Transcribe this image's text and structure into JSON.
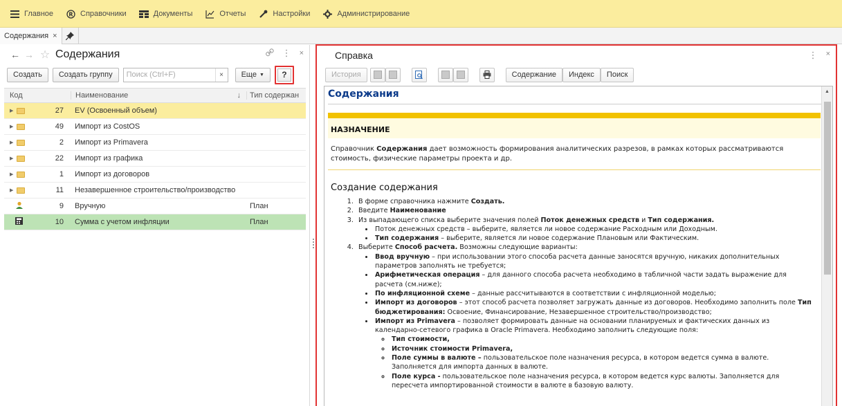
{
  "menu": [
    {
      "label": "Главное",
      "icon": "hamburger-icon"
    },
    {
      "label": "Справочники",
      "icon": "registered-icon"
    },
    {
      "label": "Документы",
      "icon": "documents-icon"
    },
    {
      "label": "Отчеты",
      "icon": "chart-icon"
    },
    {
      "label": "Настройки",
      "icon": "wrench-icon"
    },
    {
      "label": "Администрирование",
      "icon": "gear-icon"
    }
  ],
  "tabs": {
    "active": "Содержания",
    "close": "×"
  },
  "left": {
    "title": "Содержания",
    "create": "Создать",
    "create_group": "Создать группу",
    "search_placeholder": "Поиск (Ctrl+F)",
    "clear": "×",
    "more": "Еще",
    "help": "?",
    "columns": {
      "code": "Код",
      "name": "Наименование",
      "type": "Тип содержан"
    },
    "rows": [
      {
        "code": "27",
        "name": "EV (Освоенный объем)",
        "type": "",
        "kind": "folder"
      },
      {
        "code": "49",
        "name": "Импорт из CostOS",
        "type": "",
        "kind": "folder"
      },
      {
        "code": "2",
        "name": "Импорт из Primavera",
        "type": "",
        "kind": "folder"
      },
      {
        "code": "22",
        "name": "Импорт из графика",
        "type": "",
        "kind": "folder"
      },
      {
        "code": "1",
        "name": "Импорт из договоров",
        "type": "",
        "kind": "folder"
      },
      {
        "code": "11",
        "name": "Незавершенное строительство/производство",
        "type": "",
        "kind": "folder"
      },
      {
        "code": "9",
        "name": "Вручную",
        "type": "План",
        "kind": "person"
      },
      {
        "code": "10",
        "name": "Сумма с учетом инфляции",
        "type": "План",
        "kind": "calc"
      }
    ]
  },
  "right": {
    "title": "Справка",
    "history": "История",
    "contents": "Содержание",
    "index": "Индекс",
    "search": "Поиск"
  },
  "doc": {
    "title": "Содержания",
    "purpose_head": "НАЗНАЧЕНИЕ",
    "purpose_pre": "Справочник ",
    "purpose_bold": "Содержания",
    "purpose_post": " дает возможность формирования аналитических разрезов, в рамках которых рассматриваются стоимость, физические параметры проекта и др.",
    "create_head": "Создание содержания",
    "s1_pre": "В форме справочника нажмите ",
    "s1_b": "Создать.",
    "s2_pre": "Введите ",
    "s2_b": "Наименование",
    "s3_pre": "Из выпадающего списка выберите значения полей ",
    "s3_b1": "Поток денежных средств",
    "s3_mid": " и ",
    "s3_b2": "Тип содержания.",
    "s3a": "Поток денежных средств – выберите, является ли новое содержание Расходным или Доходным.",
    "s3b_b": "Тип содержания",
    "s3b": " – выберите, является ли новое содержание Плановым или Фактическим.",
    "s4_pre": "Выберите ",
    "s4_b": "Способ расчета.",
    "s4_post": " Возможны следующие варианты:",
    "m1_b": "Ввод вручную",
    "m1": " – при использовании этого способа расчета данные заносятся вручную, никаких дополнительных параметров заполнять не требуется;",
    "m2_b": "Арифметическая операция",
    "m2": " – для данного способа расчета необходимо в табличной части задать выражение для расчета (см.ниже);",
    "m3_b": "По инфляционной схеме",
    "m3": " – данные рассчитываются в соответствии с инфляционной моделью;",
    "m4_b": "Импорт из договоров",
    "m4": " – этот способ расчета позволяет загружать данные из договоров. Необходимо заполнить поле ",
    "m4_b2": "Тип бюджетирования:",
    "m4_post": " Освоение, Финансирование, Незавершенное строительство/производство;",
    "m5_b": "Импорт из Primavera",
    "m5": " – позволяет формировать данные на основании планируемых и фактических данных из календарно-сетевого графика в Oracle Primavera. Необходимо заполнить следующие поля:",
    "p1": "Тип стоимости,",
    "p2": "Источник стоимости Primavera,",
    "p3_b": "Поле суммы в валюте –",
    "p3": " пользовательское поле назначения ресурса, в котором ведется сумма в валюте. Заполняется для импорта данных в валюте.",
    "p4_b": "Поле курса -",
    "p4": " пользовательское поле назначения ресурса, в котором ведется курс валюты. Заполняется для пересчета импортированной стоимости в валюте в базовую валюту."
  }
}
